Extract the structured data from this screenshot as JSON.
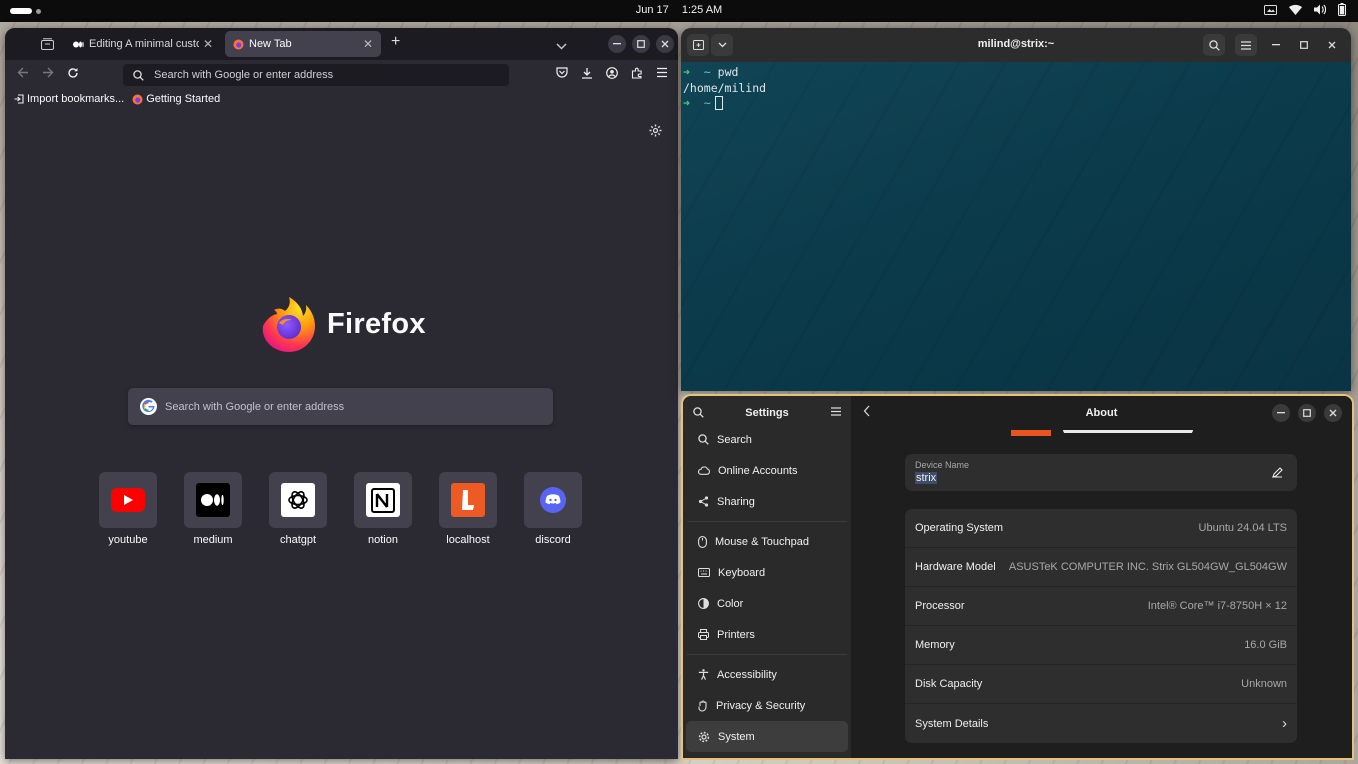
{
  "topbar": {
    "date": "Jun 17",
    "time": "1:25 AM",
    "tray_icons": [
      "screen-icon",
      "wifi-icon",
      "volume-icon",
      "battery-icon"
    ]
  },
  "firefox": {
    "tabs": [
      {
        "title": "Editing A minimal custom",
        "icon": "medium-favicon"
      },
      {
        "title": "New Tab",
        "icon": "firefox-favicon",
        "active": true
      }
    ],
    "url_placeholder": "Search with Google or enter address",
    "bookmarks": [
      {
        "label": "Import bookmarks...",
        "icon": "import-icon"
      },
      {
        "label": "Getting Started",
        "icon": "firefox-favicon"
      }
    ],
    "wordmark": "Firefox",
    "search_placeholder": "Search with Google or enter address",
    "shortcuts": [
      {
        "label": "youtube",
        "icon": "youtube-icon"
      },
      {
        "label": "medium",
        "icon": "medium-icon"
      },
      {
        "label": "chatgpt",
        "icon": "chatgpt-icon"
      },
      {
        "label": "notion",
        "icon": "notion-icon"
      },
      {
        "label": "localhost",
        "icon": "localhost-icon"
      },
      {
        "label": "discord",
        "icon": "discord-icon"
      }
    ]
  },
  "terminal": {
    "title": "milind@strix:~",
    "lines": [
      {
        "prompt": "➜",
        "dir": "~",
        "cmd": "pwd"
      },
      {
        "output": "/home/milind"
      },
      {
        "prompt": "➜",
        "dir": "~",
        "cmd": ""
      }
    ]
  },
  "settings": {
    "sidebar_title": "Settings",
    "nav": [
      {
        "label": "Search",
        "icon": "search-icon"
      },
      {
        "label": "Online Accounts",
        "icon": "cloud-icon"
      },
      {
        "label": "Sharing",
        "icon": "share-icon"
      },
      {
        "label": "Mouse & Touchpad",
        "icon": "mouse-icon"
      },
      {
        "label": "Keyboard",
        "icon": "keyboard-icon"
      },
      {
        "label": "Color",
        "icon": "color-icon"
      },
      {
        "label": "Printers",
        "icon": "printer-icon"
      },
      {
        "label": "Accessibility",
        "icon": "accessibility-icon"
      },
      {
        "label": "Privacy & Security",
        "icon": "hand-icon"
      },
      {
        "label": "System",
        "icon": "system-gear-icon",
        "active": true
      }
    ],
    "page_title": "About",
    "device_name_label": "Device Name",
    "device_name": "strix",
    "info": [
      {
        "key": "Operating System",
        "value": "Ubuntu 24.04 LTS"
      },
      {
        "key": "Hardware Model",
        "value": "ASUSTeK COMPUTER INC. Strix GL504GW_GL504GW"
      },
      {
        "key": "Processor",
        "value": "Intel® Core™ i7-8750H × 12"
      },
      {
        "key": "Memory",
        "value": "16.0 GiB"
      },
      {
        "key": "Disk Capacity",
        "value": "Unknown"
      },
      {
        "key": "System Details",
        "value": "›"
      }
    ],
    "colors": {
      "focus_border": "#e8c27a",
      "ubuntu_orange": "#e95420"
    }
  }
}
